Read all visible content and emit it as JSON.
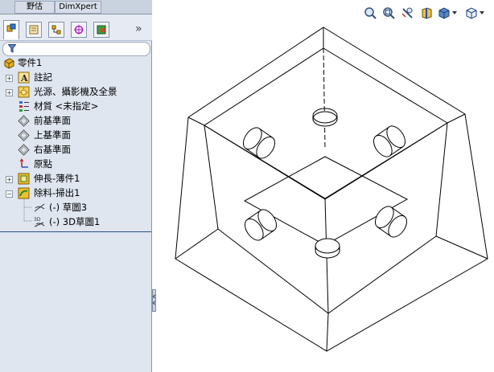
{
  "tabs": [
    "野估",
    "DimXpert"
  ],
  "panel_tabs": [
    "feature-manager",
    "property-manager",
    "configuration-manager",
    "dimxpert-manager",
    "display-manager"
  ],
  "more_glyph": "»",
  "filter_icon": "filter-icon",
  "tree": {
    "root": "零件1",
    "items": [
      {
        "label": "註記",
        "icon": "annotation-icon",
        "expandable": true,
        "expanded": false
      },
      {
        "label": "光源、攝影機及全景",
        "icon": "lights-icon",
        "expandable": true,
        "expanded": false
      },
      {
        "label": "材質 <未指定>",
        "icon": "material-icon",
        "expandable": false
      },
      {
        "label": "前基準面",
        "icon": "plane-icon",
        "expandable": false
      },
      {
        "label": "上基準面",
        "icon": "plane-icon",
        "expandable": false
      },
      {
        "label": "右基準面",
        "icon": "plane-icon",
        "expandable": false
      },
      {
        "label": "原點",
        "icon": "origin-icon",
        "expandable": false
      },
      {
        "label": "伸長-薄件1",
        "icon": "extrude-icon",
        "expandable": true,
        "expanded": false
      },
      {
        "label": "除料-掃出1",
        "icon": "sweep-cut-icon",
        "expandable": true,
        "expanded": true
      }
    ],
    "children": [
      {
        "label": "(-) 草圖3",
        "icon": "sketch-icon"
      },
      {
        "label": "(-) 3D草圖1",
        "icon": "3d-sketch-icon"
      }
    ]
  },
  "view_toolbar": [
    "zoom-to-fit-icon",
    "zoom-to-area-icon",
    "previous-view-icon",
    "section-view-icon",
    "view-orientation-icon",
    "display-style-icon"
  ],
  "colors": {
    "panel_bg": "#dfe6f0",
    "accent": "#2a4d86",
    "line": "#000000"
  }
}
